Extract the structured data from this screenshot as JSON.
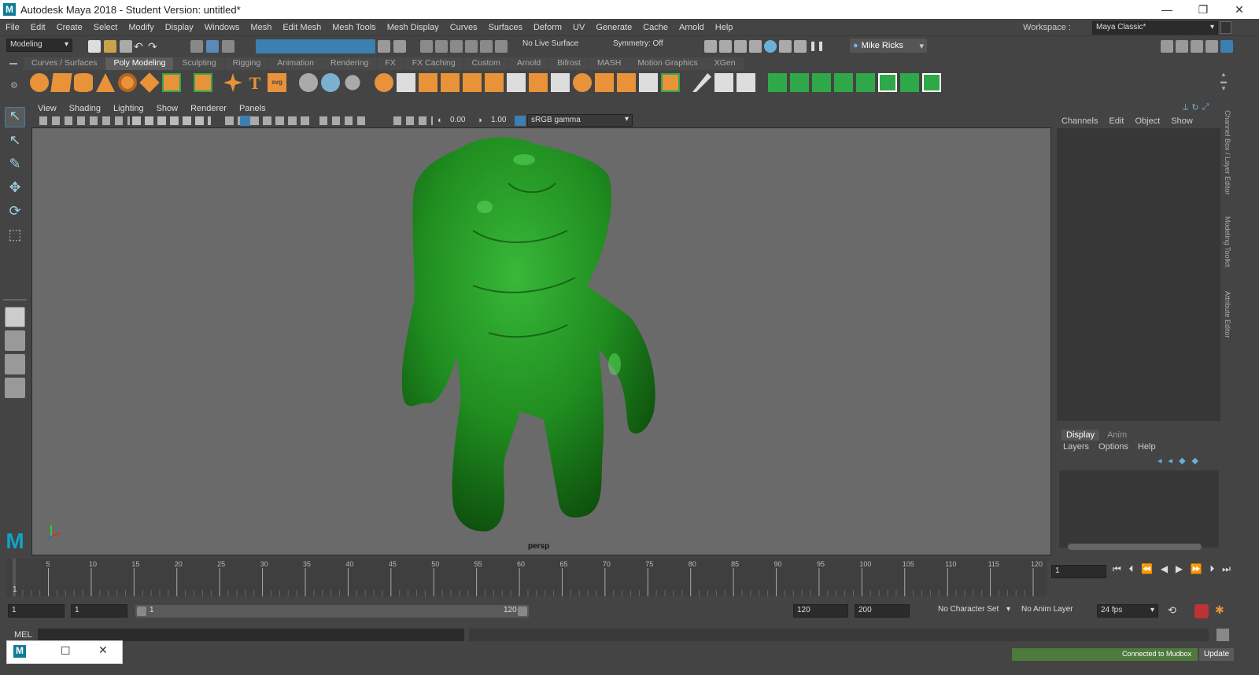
{
  "window": {
    "title": "Autodesk Maya 2018 - Student Version: untitled*",
    "logo_letter": "M",
    "minimize": "—",
    "restore": "❐",
    "close": "✕"
  },
  "menu": [
    "File",
    "Edit",
    "Create",
    "Select",
    "Modify",
    "Display",
    "Windows",
    "Mesh",
    "Edit Mesh",
    "Mesh Tools",
    "Mesh Display",
    "Curves",
    "Surfaces",
    "Deform",
    "UV",
    "Generate",
    "Cache",
    "Arnold",
    "Help"
  ],
  "workspace": {
    "label": "Workspace :",
    "value": "Maya Classic*"
  },
  "status": {
    "mode": "Modeling",
    "live_surface": "No Live Surface",
    "symmetry": "Symmetry: Off",
    "user": "Mike Ricks"
  },
  "shelf_tabs": [
    "Curves / Surfaces",
    "Poly Modeling",
    "Sculpting",
    "Rigging",
    "Animation",
    "Rendering",
    "FX",
    "FX Caching",
    "Custom",
    "Arnold",
    "Bifrost",
    "MASH",
    "Motion Graphics",
    "XGen"
  ],
  "shelf_active": "Poly Modeling",
  "viewport": {
    "menu": [
      "View",
      "Shading",
      "Lighting",
      "Show",
      "Renderer",
      "Panels"
    ],
    "exposure": "0.00",
    "gamma": "1.00",
    "colorspace": "sRGB gamma",
    "camera": "persp"
  },
  "channel_box": {
    "tabs": [
      "Channels",
      "Edit",
      "Object",
      "Show"
    ]
  },
  "layer_editor": {
    "tabs": [
      "Display",
      "Anim"
    ],
    "menu": [
      "Layers",
      "Options",
      "Help"
    ]
  },
  "side_tabs": [
    "Channel Box / Layer Editor",
    "Modeling Toolkit",
    "Attribute Editor"
  ],
  "timeline": {
    "ticks": [
      "5",
      "10",
      "15",
      "20",
      "25",
      "30",
      "35",
      "40",
      "45",
      "50",
      "55",
      "60",
      "65",
      "70",
      "75",
      "80",
      "85",
      "90",
      "95",
      "100",
      "105",
      "110",
      "115",
      "120"
    ],
    "start_label": "1",
    "current_frame": "1"
  },
  "range": {
    "start": "1",
    "anim_start": "1",
    "slider_start": "1",
    "slider_end": "120",
    "end": "120",
    "anim_end": "200",
    "character_set": "No Character Set",
    "anim_layer": "No Anim Layer",
    "fps": "24 fps"
  },
  "command": {
    "lang": "MEL"
  },
  "help": {
    "status": "Connected to Mudbox",
    "update": "Update"
  },
  "colors": {
    "mesh": "#1f8c1f",
    "shelf_orange": "#e8923a",
    "shelf_green": "#2fa84a",
    "select_blue": "#3c7fb1"
  }
}
